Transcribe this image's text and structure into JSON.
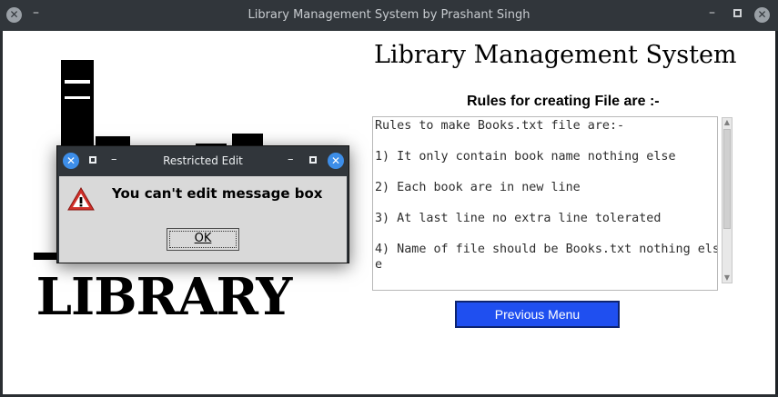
{
  "window": {
    "title": "Library Management System by Prashant Singh",
    "close_glyph": "✕",
    "minimize_glyph": "–"
  },
  "main": {
    "app_title": "Library Management System",
    "rules_heading": "Rules for creating File are :-",
    "rules_text": [
      "Rules to make Books.txt file are:-",
      "",
      "1) It only contain book name nothing else",
      "",
      "2) Each book are in new line",
      "",
      "3) At last line no extra line tolerated",
      "",
      "4) Name of file should be Books.txt nothing els",
      "e"
    ],
    "previous_button": "Previous Menu",
    "logo_text": "LIBRARY"
  },
  "dialog": {
    "title": "Restricted Edit",
    "message": "You can't edit message box",
    "ok_label": "OK",
    "close_glyph": "✕",
    "minimize_glyph": "–"
  },
  "colors": {
    "titlebar_bg": "#31363b",
    "accent_button": "#1f4ff0",
    "dialog_close": "#3d8ee9",
    "warning_red": "#d0302a"
  },
  "icons": [
    "close-icon",
    "maximize-icon",
    "minimize-icon",
    "warning-icon",
    "scroll-up-icon",
    "scroll-down-icon"
  ]
}
